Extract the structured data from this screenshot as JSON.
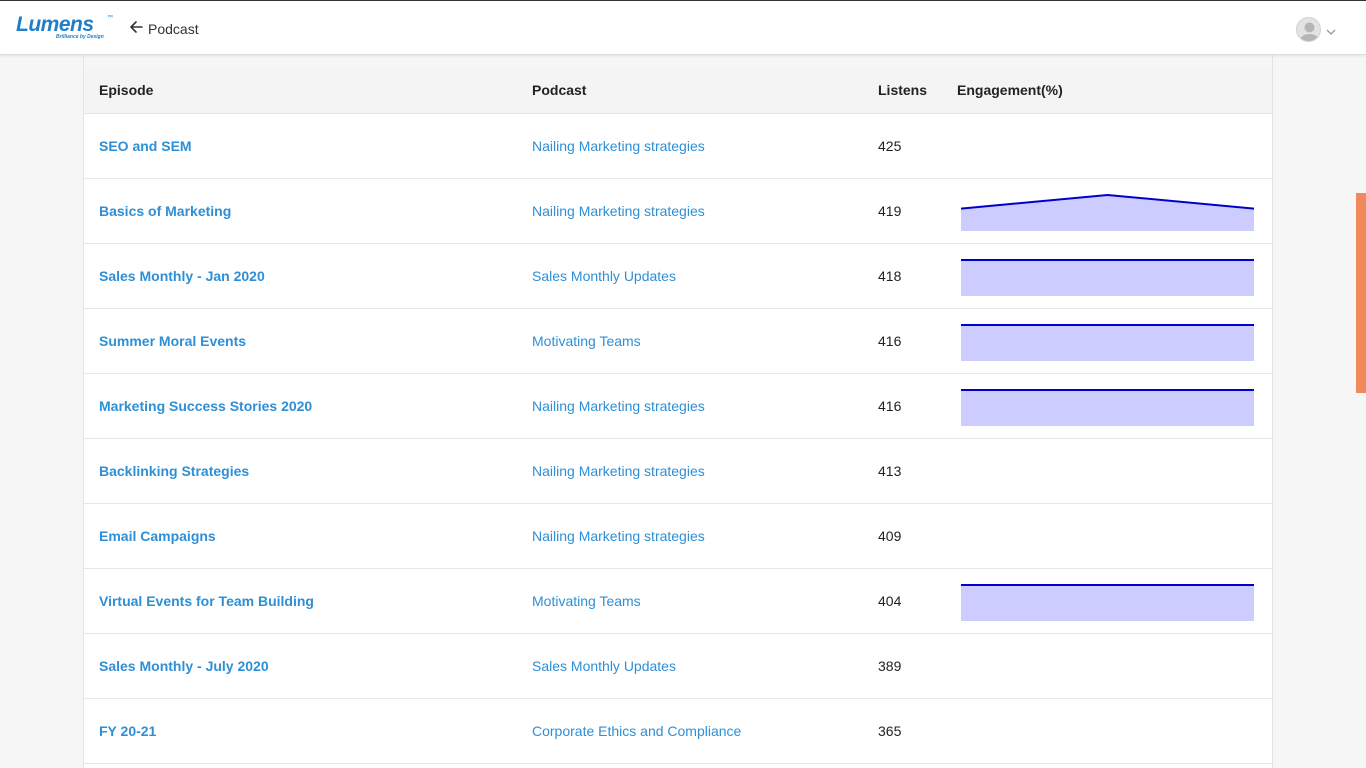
{
  "header": {
    "logo_text": "Lumens",
    "logo_tm": "™",
    "logo_tagline": "Brilliance by Design",
    "back_label": "Podcast"
  },
  "table": {
    "columns": {
      "episode": "Episode",
      "podcast": "Podcast",
      "listens": "Listens",
      "engagement": "Engagement(%)"
    },
    "rows": [
      {
        "episode": "SEO and SEM",
        "podcast": "Nailing Marketing strategies",
        "listens": "425",
        "engagement": null
      },
      {
        "episode": "Basics of Marketing",
        "podcast": "Nailing Marketing strategies",
        "listens": "419",
        "engagement": [
          60,
          100,
          60
        ]
      },
      {
        "episode": "Sales Monthly - Jan 2020",
        "podcast": "Sales Monthly Updates",
        "listens": "418",
        "engagement": [
          100,
          100
        ]
      },
      {
        "episode": "Summer Moral Events",
        "podcast": "Motivating Teams",
        "listens": "416",
        "engagement": [
          100,
          100
        ]
      },
      {
        "episode": "Marketing Success Stories 2020",
        "podcast": "Nailing Marketing strategies",
        "listens": "416",
        "engagement": [
          100,
          100
        ]
      },
      {
        "episode": "Backlinking Strategies",
        "podcast": "Nailing Marketing strategies",
        "listens": "413",
        "engagement": null
      },
      {
        "episode": "Email Campaigns",
        "podcast": "Nailing Marketing strategies",
        "listens": "409",
        "engagement": null
      },
      {
        "episode": "Virtual Events for Team Building",
        "podcast": "Motivating Teams",
        "listens": "404",
        "engagement": [
          100,
          100
        ]
      },
      {
        "episode": "Sales Monthly - July 2020",
        "podcast": "Sales Monthly Updates",
        "listens": "389",
        "engagement": null
      },
      {
        "episode": "FY 20-21",
        "podcast": "Corporate Ethics and Compliance",
        "listens": "365",
        "engagement": null
      }
    ]
  },
  "colors": {
    "accent": "#2e8fd6",
    "spark_line": "#0000cc",
    "spark_fill": "#ccccff",
    "scroll_thumb": "#f08a5d"
  },
  "icons": {
    "back": "arrow-left-icon",
    "avatar": "user-avatar-icon",
    "caret": "chevron-down-icon"
  }
}
